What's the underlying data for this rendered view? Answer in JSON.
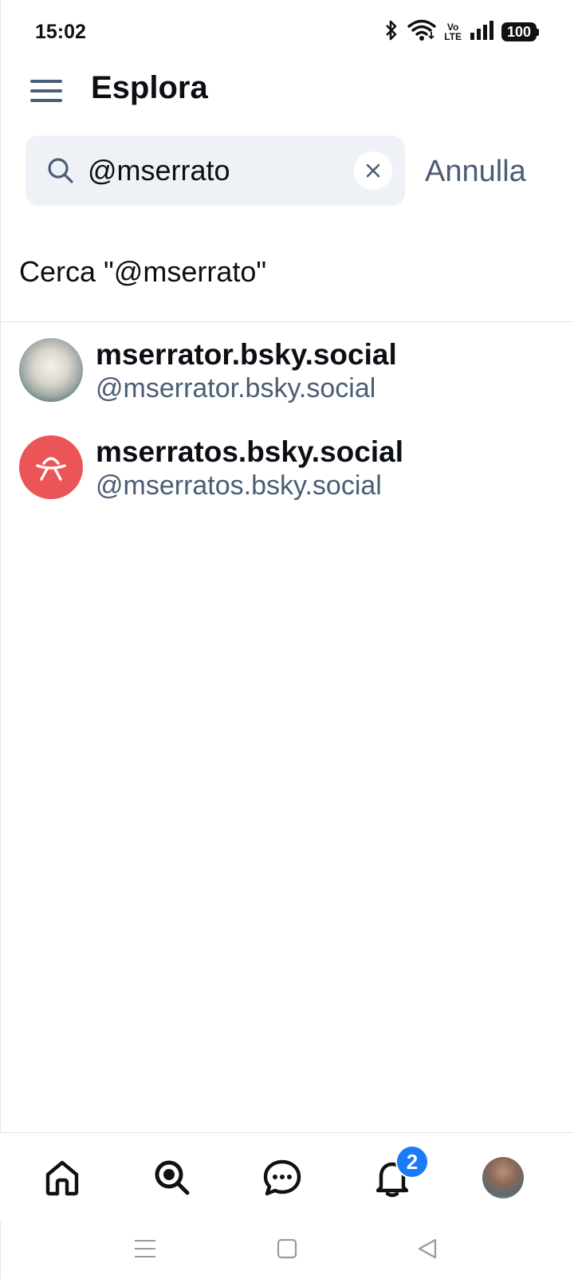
{
  "status_bar": {
    "time": "15:02",
    "battery": "100",
    "volte_top": "Vo",
    "volte_bottom": "LTE",
    "icons": [
      "bluetooth-icon",
      "wifi-icon",
      "volte-icon",
      "signal-icon",
      "battery-icon"
    ]
  },
  "header": {
    "title": "Esplora",
    "menu_icon": "hamburger-menu-icon"
  },
  "search": {
    "value": "@mserrato",
    "cancel_label": "Annulla",
    "search_icon": "search-icon",
    "clear_icon": "close-icon"
  },
  "query_row": {
    "label": "Cerca \"@mserrato\""
  },
  "results": [
    {
      "name": "mserrator.bsky.social",
      "handle": "@mserrator.bsky.social"
    },
    {
      "name": "mserratos.bsky.social",
      "handle": "@mserratos.bsky.social"
    }
  ],
  "bottom_nav": {
    "items": [
      "home-icon",
      "search-icon",
      "chat-icon",
      "notifications-icon",
      "profile-avatar"
    ],
    "notifications_badge": "2"
  },
  "colors": {
    "accent": "#1a7af8",
    "muted_text": "#4b5d75",
    "search_bg": "#eef2f7",
    "avatar_red": "#ec5558"
  }
}
